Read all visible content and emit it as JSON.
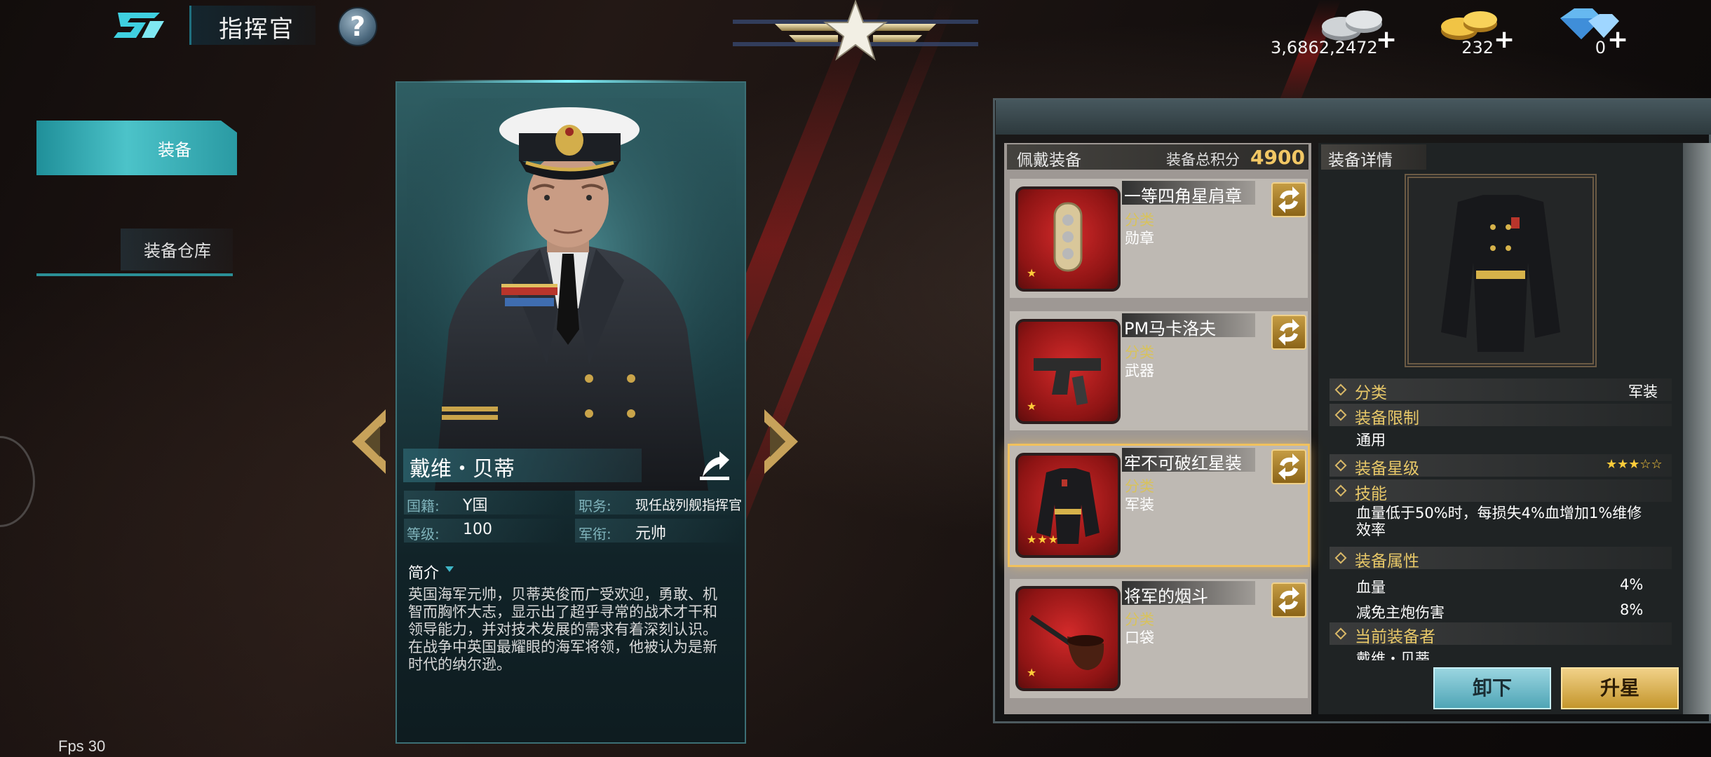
{
  "header": {
    "title": "指挥官",
    "help_label": "?",
    "currencies": [
      {
        "name": "silver-coins",
        "value": "3,6862,2472",
        "plus": "+"
      },
      {
        "name": "gold-coins",
        "value": "232",
        "plus": "+"
      },
      {
        "name": "diamonds",
        "value": "0",
        "plus": "+"
      }
    ]
  },
  "left_tabs": {
    "equip": "装备",
    "warehouse": "装备仓库"
  },
  "commander": {
    "name": "戴维・贝蒂",
    "country_label": "国籍:",
    "country": "Y国",
    "duty_label": "职务:",
    "duty": "现任战列舰指挥官",
    "level_label": "等级:",
    "level": "100",
    "rank_label": "军衔:",
    "rank": "元帅",
    "intro_label": "简介",
    "intro": "英国海军元帅，贝蒂英俊而广受欢迎，勇敢、机智而胸怀大志，显示出了超乎寻常的战术才干和领导能力，并对技术发展的需求有着深刻认识。在战争中英国最耀眼的海军将领，他被认为是新时代的纳尔逊。"
  },
  "worn": {
    "header": "佩戴装备",
    "score_label": "装备总积分",
    "score": "4900",
    "items": [
      {
        "name": "一等四角星肩章",
        "cat_label": "分类",
        "category": "勋章",
        "stars": "★"
      },
      {
        "name": "PM马卡洛夫",
        "cat_label": "分类",
        "category": "武器",
        "stars": "★"
      },
      {
        "name": "牢不可破红星装",
        "cat_label": "分类",
        "category": "军装",
        "stars": "★★★"
      },
      {
        "name": "将军的烟斗",
        "cat_label": "分类",
        "category": "口袋",
        "stars": "★"
      }
    ]
  },
  "detail": {
    "header": "装备详情",
    "category_label": "分类",
    "category": "军装",
    "limit_label": "装备限制",
    "limit": "通用",
    "star_label": "装备星级",
    "stars": "★★★☆☆",
    "skill_label": "技能",
    "skill": "血量低于50%时，每损失4%血增加1%维修效率",
    "attr_label": "装备属性",
    "attrs": [
      {
        "name": "血量",
        "value": "4%"
      },
      {
        "name": "减免主炮伤害",
        "value": "8%"
      }
    ],
    "owner_label": "当前装备者",
    "owner": "戴维・贝蒂"
  },
  "buttons": {
    "unload": "卸下",
    "upgrade": "升星"
  },
  "fps": "Fps 30",
  "colors": {
    "accent_teal": "#4cc3c9",
    "gold": "#f1c765",
    "item_red": "#d32a2a"
  }
}
